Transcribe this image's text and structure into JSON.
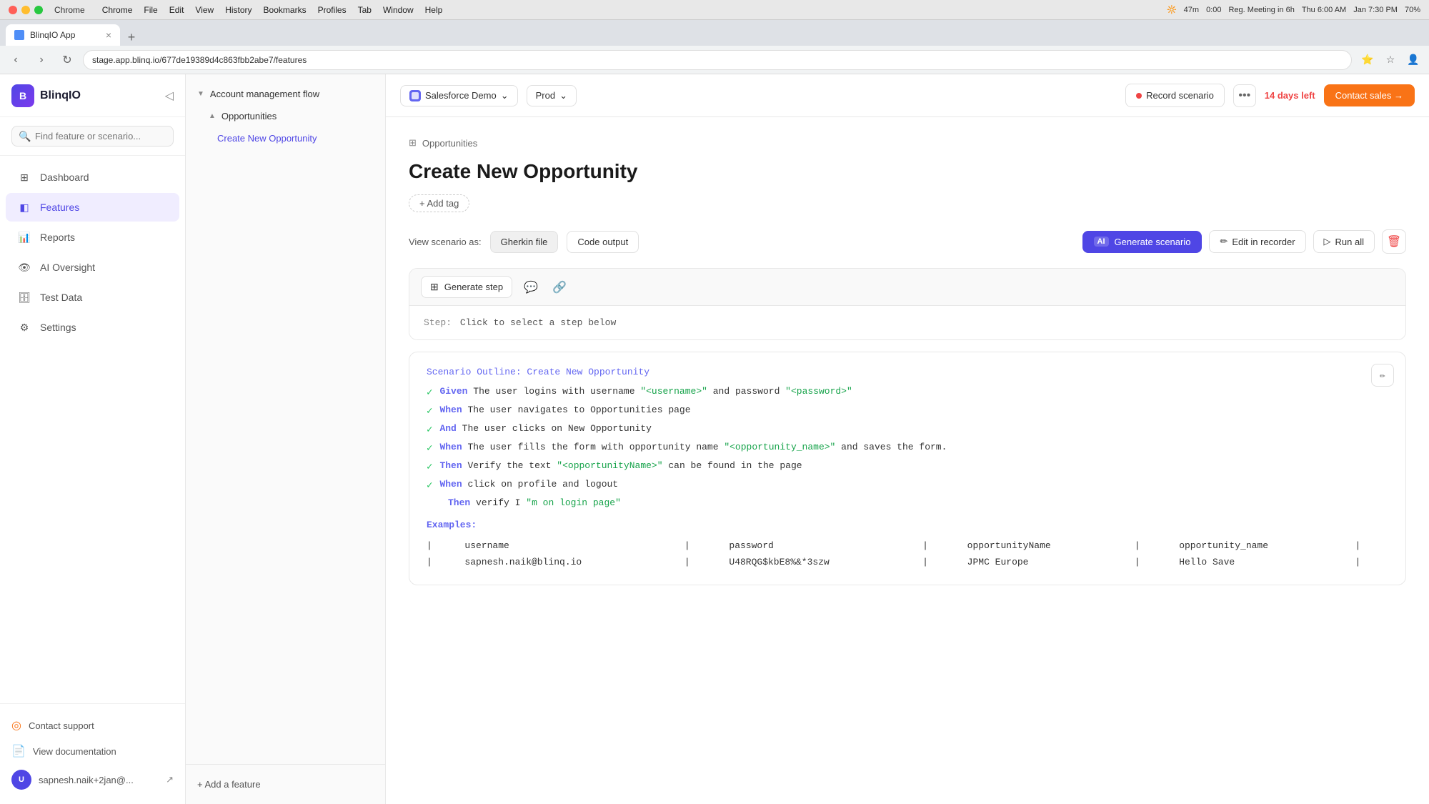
{
  "mac": {
    "app": "Chrome",
    "menu_items": [
      "Chrome",
      "File",
      "Edit",
      "View",
      "History",
      "Bookmarks",
      "Profiles",
      "Tab",
      "Window",
      "Help"
    ],
    "status": "47m  0:00  Reg. Meeting in 6h  Thu 6:00 AM  Jan 7:30 PM  70%"
  },
  "chrome": {
    "tab_title": "BlinqIO App",
    "url": "stage.app.blinq.io/677de19389d4c863fbb2abe7/features",
    "new_tab_label": "+"
  },
  "sidebar": {
    "logo_letter": "B",
    "app_name": "BlinqIO",
    "search_placeholder": "Find feature or scenario...",
    "nav_items": [
      {
        "id": "dashboard",
        "label": "Dashboard",
        "icon": "grid"
      },
      {
        "id": "features",
        "label": "Features",
        "icon": "layers",
        "active": true
      },
      {
        "id": "reports",
        "label": "Reports",
        "icon": "bar-chart"
      },
      {
        "id": "ai-oversight",
        "label": "AI Oversight",
        "icon": "eye"
      },
      {
        "id": "test-data",
        "label": "Test Data",
        "icon": "database"
      },
      {
        "id": "settings",
        "label": "Settings",
        "icon": "gear"
      }
    ],
    "bottom": {
      "contact_support": "Contact support",
      "view_docs": "View documentation",
      "user_email": "sapnesh.naik+2jan@...",
      "user_initials": "U"
    }
  },
  "feature_tree": {
    "groups": [
      {
        "label": "Account management flow",
        "expanded": true,
        "sub_items": [
          {
            "label": "Opportunities",
            "expanded": true
          },
          {
            "label": "Create New Opportunity",
            "active": true
          }
        ]
      }
    ],
    "add_feature": "+ Add a feature"
  },
  "topbar": {
    "env_selector": "Salesforce Demo",
    "env_selector_arrow": "⌄",
    "branch_selector": "Prod",
    "branch_arrow": "⌄",
    "record_btn": "Record scenario",
    "more_btn": "•••",
    "trial_prefix": "14 days left",
    "contact_sales": "Contact sales →"
  },
  "content": {
    "breadcrumb": "Opportunities",
    "page_title": "Create New Opportunity",
    "add_tag": "+ Add tag",
    "view_label": "View scenario as:",
    "view_gherkin": "Gherkin file",
    "view_code": "Code output",
    "generate_scenario": "Generate scenario",
    "ai_badge": "AI",
    "edit_recorder": "Edit in recorder",
    "run_all": "Run all",
    "delete_icon": "🗑",
    "generate_step": "Generate step",
    "step_hint_label": "Step:",
    "step_hint_text": "Click to select a step below",
    "scenario": {
      "outline_label": "Scenario Outline",
      "outline_name": ": Create New Opportunity",
      "steps": [
        {
          "checked": true,
          "keyword": "Given",
          "text": "The user logins with username ",
          "param1": "\"<username>\"",
          "text2": " and password ",
          "param2": "\"<password>\""
        },
        {
          "checked": true,
          "keyword": "When",
          "text": "The user navigates to Opportunities page",
          "param1": "",
          "text2": "",
          "param2": ""
        },
        {
          "checked": true,
          "keyword": "And",
          "text": "The user clicks on New Opportunity",
          "param1": "",
          "text2": "",
          "param2": ""
        },
        {
          "checked": true,
          "keyword": "When",
          "text": "The user fills the form with opportunity name ",
          "param1": "\"<opportunity_name>\"",
          "text2": " and saves the form.",
          "param2": ""
        },
        {
          "checked": true,
          "keyword": "Then",
          "text": "Verify the text ",
          "param1": "\"<opportunityName>\"",
          "text2": " can be found in the page",
          "param2": ""
        },
        {
          "checked": true,
          "keyword": "When",
          "text": "click on profile and logout",
          "param1": "",
          "text2": "",
          "param2": ""
        },
        {
          "checked": false,
          "keyword": "Then",
          "text": "verify I",
          "param1": "\"m on login page\"",
          "text2": "",
          "param2": ""
        }
      ],
      "examples_label": "Examples:",
      "table_headers": [
        "username",
        "password",
        "opportunityName",
        "opportunity_name"
      ],
      "table_rows": [
        [
          "sapnesh.naik@blinq.io",
          "U48RQG$kbE8%&*3szw",
          "JPMC Europe",
          "Hello Save"
        ]
      ]
    }
  }
}
